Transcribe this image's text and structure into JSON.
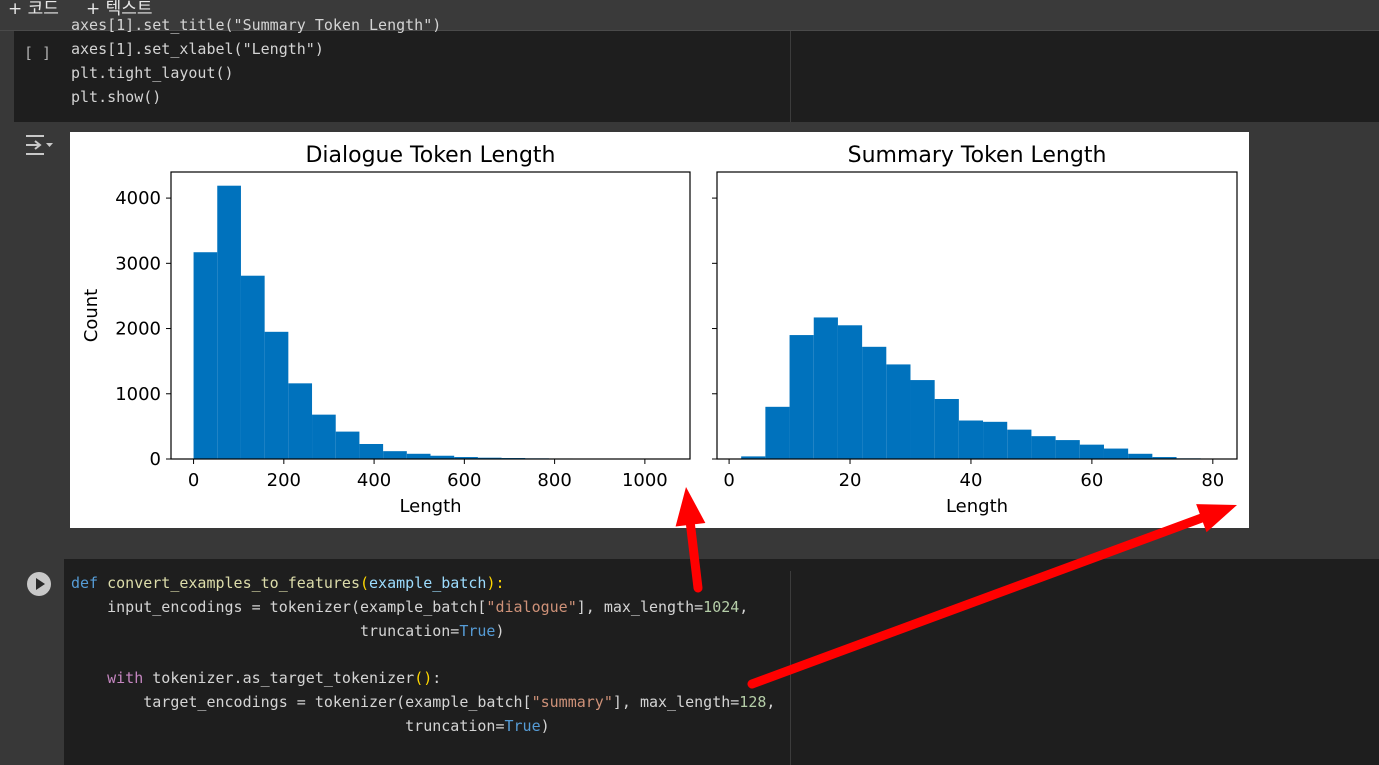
{
  "toolbar": {
    "add_code": "+ 코드",
    "add_text": "+ 텍스트"
  },
  "cell1": {
    "run_indicator": "[ ]",
    "lines": [
      "axes[1].set_title(\"Summary Token Length\")",
      "axes[1].set_xlabel(\"Length\")",
      "plt.tight_layout()",
      "plt.show()"
    ]
  },
  "output_icon": "output-toggle-icon",
  "chart_data": [
    {
      "type": "bar",
      "title": "Dialogue Token Length",
      "xlabel": "Length",
      "ylabel": "Count",
      "xlim": [
        -50,
        1100
      ],
      "ylim": [
        0,
        4400
      ],
      "xticks": [
        "0",
        "200",
        "400",
        "600",
        "800",
        "1000"
      ],
      "yticks": [
        "0",
        "1000",
        "2000",
        "3000",
        "4000"
      ],
      "bin_edges": [
        0,
        52.5,
        105,
        157.5,
        210,
        262.5,
        315,
        367.5,
        420,
        472.5,
        525,
        577.5,
        630,
        682.5,
        735,
        787.5,
        840,
        892.5,
        945,
        997.5,
        1050
      ],
      "values": [
        3170,
        4190,
        2810,
        1950,
        1160,
        680,
        420,
        230,
        120,
        80,
        50,
        30,
        20,
        15,
        10,
        8,
        6,
        5,
        4,
        3
      ]
    },
    {
      "type": "bar",
      "title": "Summary Token Length",
      "xlabel": "Length",
      "ylabel": "",
      "xlim": [
        -2,
        84
      ],
      "ylim": [
        0,
        4400
      ],
      "xticks": [
        "0",
        "20",
        "40",
        "60",
        "80"
      ],
      "bin_edges": [
        2,
        6,
        10,
        14,
        18,
        22,
        26,
        30,
        34,
        38,
        42,
        46,
        50,
        54,
        58,
        62,
        66,
        70,
        74,
        78
      ],
      "values": [
        40,
        800,
        1900,
        2170,
        2050,
        1720,
        1450,
        1210,
        920,
        590,
        570,
        450,
        350,
        290,
        220,
        160,
        80,
        30,
        10
      ]
    }
  ],
  "cell2": {
    "line1_kw": "def",
    "line1_fn": "convert_examples_to_features",
    "line1_open": "(",
    "line1_arg": "example_batch",
    "line1_close": "):",
    "line2_a": "    input_encodings = tokenizer(example_batch[",
    "line2_str": "\"dialogue\"",
    "line2_b": "], max_length=",
    "line2_num": "1024",
    "line2_c": ",",
    "line3_a": "                                truncation=",
    "line3_kw": "True",
    "line3_b": ")",
    "line5_kw": "    with",
    "line5_a": " tokenizer.as_target_tokenizer",
    "line5_br": "()",
    "line5_b": ":",
    "line6_a": "        target_encodings = tokenizer(example_batch[",
    "line6_str": "\"summary\"",
    "line6_b": "], max_length=",
    "line6_num": "128",
    "line6_c": ",",
    "line7_a": "                                     truncation=",
    "line7_kw": "True",
    "line7_b": ")"
  },
  "annotation": {
    "arrow_color": "#ff0000"
  }
}
